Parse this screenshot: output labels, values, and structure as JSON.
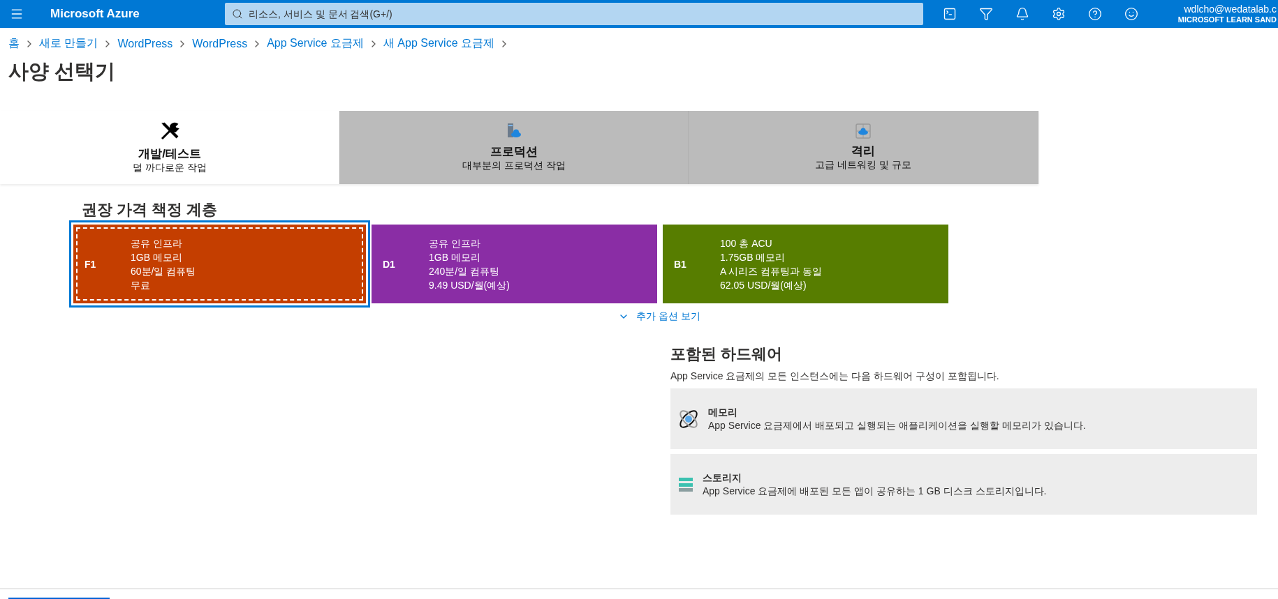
{
  "top_bar": {
    "brand": "Microsoft Azure",
    "search": {
      "placeholder": "리소스, 서비스 및 문서 검색(G+/)"
    },
    "account": {
      "email": "wdlcho@wedatalab.c",
      "directory": "MICROSOFT LEARN SAND"
    }
  },
  "breadcrumb": [
    "홈",
    "새로 만들기",
    "WordPress",
    "WordPress",
    "App Service 요금제",
    "새 App Service 요금제"
  ],
  "title": "사양 선택기",
  "tabs": [
    {
      "kind": "tools",
      "label": "개발/테스트",
      "sublabel": "덜 까다로운 작업",
      "selected": true
    },
    {
      "kind": "server",
      "label": "프로덕션",
      "sublabel": "대부분의 프로덕션 작업",
      "selected": false
    },
    {
      "kind": "isolated",
      "label": "격리",
      "sublabel": "고급 네트워킹 및 규모",
      "selected": false
    }
  ],
  "recommended": {
    "heading": "권장 가격 책정 계층",
    "tiers": [
      {
        "code": "F1",
        "lines": [
          "공유 인프라",
          "1GB 메모리",
          "60분/일 컴퓨팅",
          "무료"
        ],
        "color": "#c43e00",
        "selected": true
      },
      {
        "code": "D1",
        "lines": [
          "공유 인프라",
          "1GB 메모리",
          "240분/일 컴퓨팅",
          "9.49 USD/월(예상)"
        ],
        "color": "#8a2da5",
        "selected": false
      },
      {
        "code": "B1",
        "lines": [
          "100 총 ACU",
          "1.75GB 메모리",
          "A 시리즈 컴퓨팅과 동일",
          "62.05 USD/월(예상)"
        ],
        "color": "#577d00",
        "selected": false
      }
    ],
    "more_link": "추가 옵션 보기"
  },
  "hardware": {
    "heading": "포함된 하드웨어",
    "description": "App Service 요금제의 모든 인스턴스에는 다음 하드웨어 구성이 포함됩니다.",
    "items": [
      {
        "kind": "memory",
        "title": "메모리",
        "text": "App Service 요금제에서 배포되고 실행되는 애플리케이션을 실행할 메모리가 있습니다."
      },
      {
        "kind": "storage",
        "title": "스토리지",
        "text": "App Service 요금제에 배포된 모든 앱이 공유하는 1 GB 디스크 스토리지입니다."
      }
    ]
  }
}
